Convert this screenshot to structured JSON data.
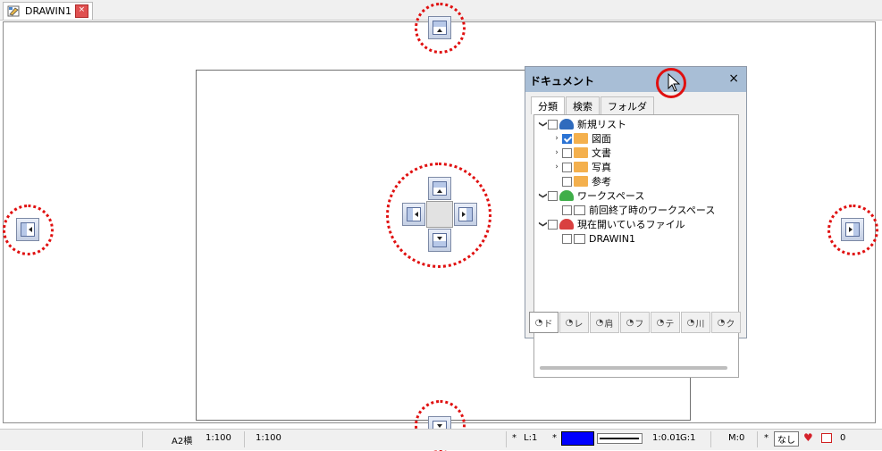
{
  "tab": {
    "label": "DRAWIN1",
    "close_glyph": "×"
  },
  "panel": {
    "title": "ドキュメント",
    "close_glyph": "×",
    "tabs": [
      "分類",
      "検索",
      "フォルダ"
    ],
    "tree": [
      {
        "label": "新規リスト",
        "expand": "❯",
        "checked": false,
        "icon": "cloud-blue"
      },
      {
        "label": "図面",
        "expand": "›",
        "checked": true,
        "icon": "folder"
      },
      {
        "label": "文書",
        "expand": "›",
        "checked": false,
        "icon": "folder"
      },
      {
        "label": "写真",
        "expand": "›",
        "checked": false,
        "icon": "folder"
      },
      {
        "label": "参考",
        "expand": "",
        "checked": false,
        "icon": "folder"
      },
      {
        "label": "ワークスペース",
        "expand": "❯",
        "checked": false,
        "icon": "cloud-green"
      },
      {
        "label": "前回終了時のワークスペース",
        "expand": "",
        "checked": false,
        "icon": "doc"
      },
      {
        "label": "現在開いているファイル",
        "expand": "❯",
        "checked": false,
        "icon": "cloud-red"
      },
      {
        "label": "DRAWIN1",
        "expand": "",
        "checked": false,
        "icon": "doc"
      }
    ],
    "bottom_tabs": [
      "ド",
      "レ",
      "肩",
      "フ",
      "テ",
      "川",
      "ク"
    ]
  },
  "status": {
    "paper": "A2横",
    "scale1": "1:100",
    "scale2": "1:100",
    "star1": "*",
    "layer": "L:1",
    "star2": "*",
    "line_scale": "1:0.01",
    "group": "G:1",
    "mode": "M:0",
    "star3": "*",
    "hatch": "なし",
    "count": "0"
  },
  "colors": {
    "accent_blue": "#0000ff",
    "ring_red": "#e01010",
    "title_bar": "#a8bed6"
  }
}
